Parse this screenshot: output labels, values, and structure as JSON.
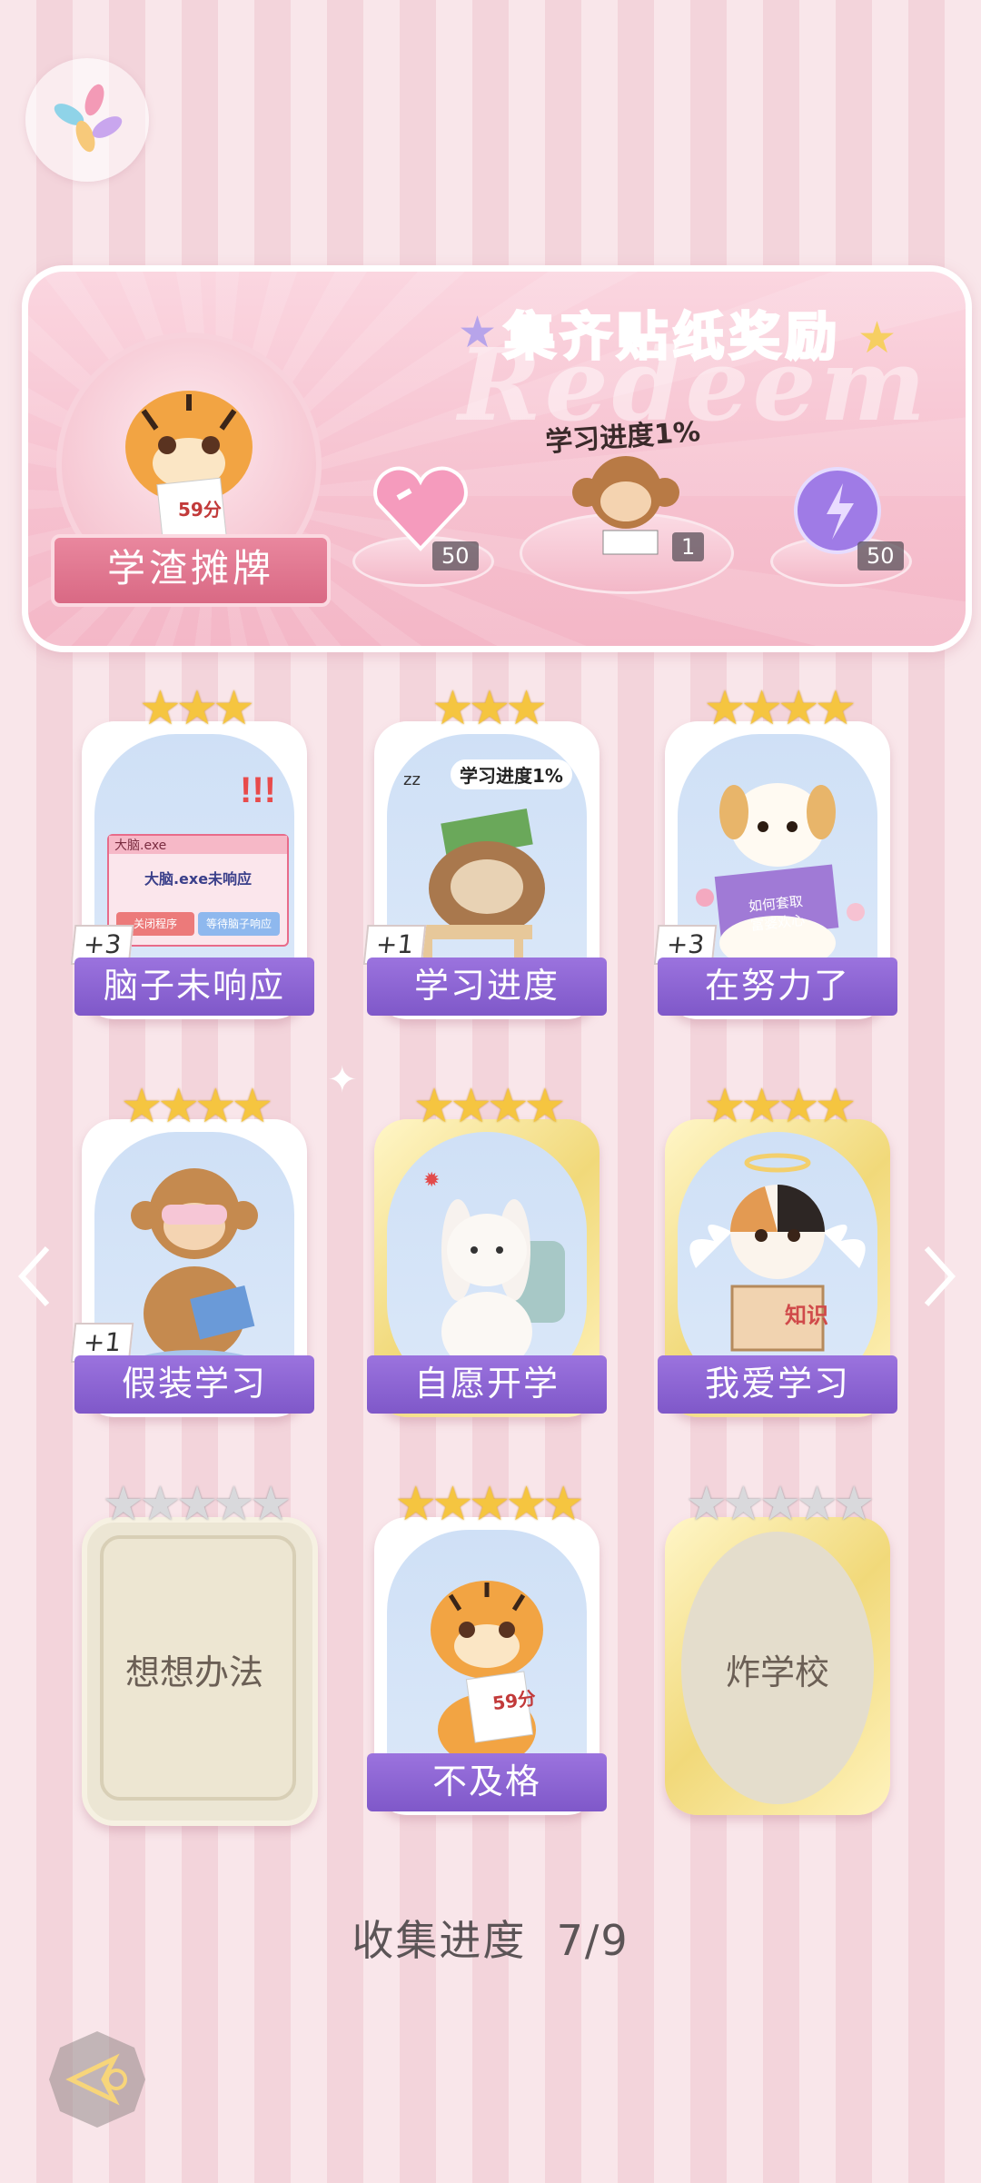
{
  "header": {
    "app_icon": "pinwheel-icon"
  },
  "reward_panel": {
    "title": "集齐贴纸奖励",
    "watermark": "Redeem",
    "badge_title": "学渣摊牌",
    "badge_score": "59分",
    "monkey_caption": "学习进度1%",
    "rewards": [
      {
        "name": "pink-heart-gem-icon",
        "count": "50"
      },
      {
        "name": "monkey-sticker-icon",
        "count": "1"
      },
      {
        "name": "purple-orb-icon",
        "count": "50"
      }
    ]
  },
  "cards": [
    {
      "id": "brain-unresponsive",
      "label": "脑子未响应",
      "stars": 3,
      "max_stars": 3,
      "bonus": "+3",
      "owned": true,
      "dialog": {
        "title": "大脑.exe",
        "message": "大脑.exe未响应",
        "btn_close": "关闭程序",
        "btn_wait": "等待脑子响应"
      }
    },
    {
      "id": "study-progress",
      "label": "学习进度",
      "stars": 3,
      "max_stars": 3,
      "bonus": "+1",
      "owned": true,
      "caption": "学习进度1%"
    },
    {
      "id": "trying-hard",
      "label": "在努力了",
      "stars": 4,
      "max_stars": 4,
      "bonus": "+3",
      "owned": true,
      "book_text": "如何套取富婆欢心"
    },
    {
      "id": "pretend-study",
      "label": "假装学习",
      "stars": 4,
      "max_stars": 4,
      "bonus": "+1",
      "owned": true
    },
    {
      "id": "voluntary-school",
      "label": "自愿开学",
      "stars": 4,
      "max_stars": 4,
      "bonus": "",
      "owned": true
    },
    {
      "id": "love-study",
      "label": "我爱学习",
      "stars": 4,
      "max_stars": 4,
      "bonus": "",
      "owned": true,
      "book_text": "知识"
    },
    {
      "id": "think-way",
      "label": "想想办法",
      "stars": 5,
      "max_stars": 5,
      "bonus": "",
      "owned": false
    },
    {
      "id": "failed",
      "label": "不及格",
      "stars": 5,
      "max_stars": 5,
      "bonus": "",
      "owned": true,
      "paper_text": "59分"
    },
    {
      "id": "bomb-school",
      "label": "炸学校",
      "stars": 5,
      "max_stars": 5,
      "bonus": "",
      "owned": false
    }
  ],
  "footer": {
    "progress_label": "收集进度",
    "progress_value": "7/9",
    "collected": 7,
    "total": 9
  },
  "colors": {
    "accent_purple": "#8a63d2",
    "accent_pink": "#e86b8a",
    "star_gold": "#f5c540"
  }
}
